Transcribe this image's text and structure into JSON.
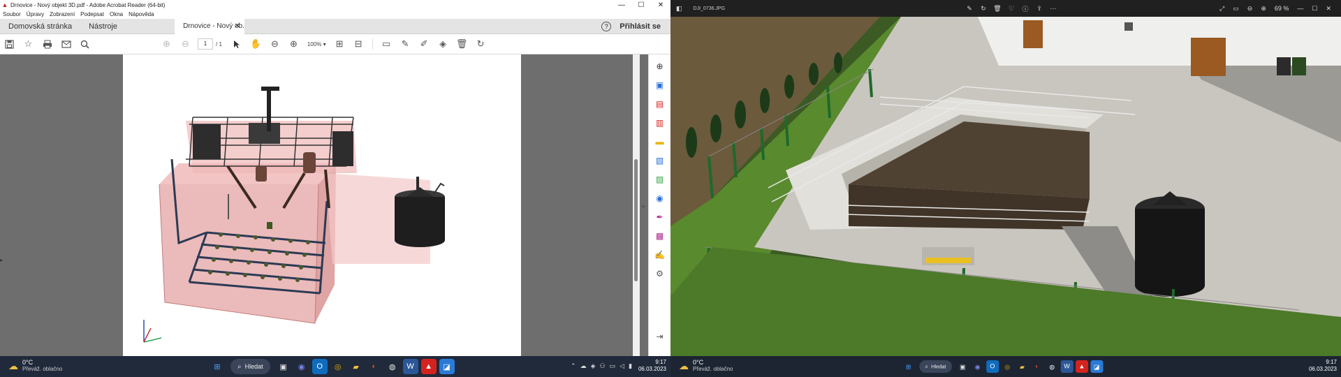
{
  "acrobat": {
    "window_title": "Drnovice - Nový objekt 3D.pdf - Adobe Acrobat Reader (64-bit)",
    "menu": [
      "Soubor",
      "Úpravy",
      "Zobrazení",
      "Podepsat",
      "Okna",
      "Nápověda"
    ],
    "tabs": {
      "home": "Domovská stránka",
      "tools": "Nástroje",
      "document": "Drnovice - Nový ob..."
    },
    "sign_in": "Přihlásit se",
    "help_glyph": "?",
    "page_current": "1",
    "page_total": "/ 1",
    "zoom": "100%"
  },
  "photos": {
    "file_name": "DJI_0736.JPG",
    "zoom": "69 %"
  },
  "taskbar_left": {
    "temperature": "0°C",
    "condition": "Převáž. oblačno",
    "search": "Hledat",
    "time": "9:17",
    "date": "06.03.2023"
  },
  "taskbar_right": {
    "temperature": "0°C",
    "condition": "Převáž. oblačno",
    "search": "Hledat",
    "time": "9:17",
    "date": "06.03.2023"
  },
  "colors": {
    "acrobat_red": "#d4231f",
    "tank_pink": "#e6a3a3",
    "grass": "#4f7d2c",
    "taskbar": "#202a3a"
  }
}
